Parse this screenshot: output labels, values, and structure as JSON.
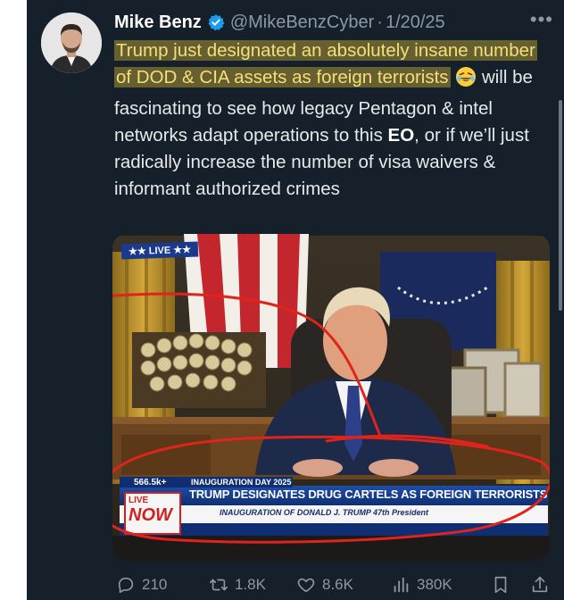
{
  "tweet": {
    "author_name": "Mike Benz",
    "handle": "@MikeBenzCyber",
    "separator": "·",
    "date": "1/20/25",
    "more_icon": "more-icon",
    "text": {
      "hl1": "Trump just designated an absolutely insane number of DOD & CIA assets as foreign terrorists",
      "emoji": "laughing-emoji",
      "part2": " will be fascinating to see how legacy Pentagon & intel networks adapt operations to this ",
      "bold": "EO",
      "part3": ", or if we’ll just radically increase the number of visa waivers & informant authorized crimes"
    }
  },
  "media": {
    "live_badge": "★★ LIVE ★★",
    "viewers": "566.5k+",
    "category": "INAUGURATION DAY 2025",
    "headline": "TRUMP DESIGNATES DRUG CARTELS AS FOREIGN TERRORISTS",
    "subline": "INAUGURATION OF DONALD J. TRUMP 47th President",
    "now_small": "LIVE",
    "now_big": "NOW",
    "annotation_color": "#e0231b"
  },
  "actions": {
    "replies": "210",
    "reposts": "1.8K",
    "likes": "8.6K",
    "views": "380K"
  },
  "colors": {
    "background": "#15202b",
    "text": "#e7e9ea",
    "muted": "#8b98a5",
    "highlight": "#d6b835",
    "verified": "#1d9bf0"
  }
}
